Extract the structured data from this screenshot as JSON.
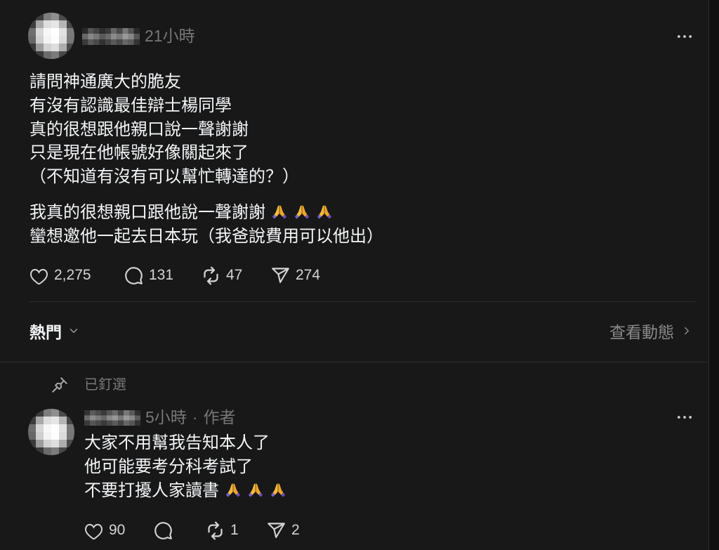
{
  "theme": {
    "page_background": "#101010",
    "card_background": "#181818",
    "primary_text": "#f3f5f7",
    "secondary_text": "#777777",
    "divider": "#2e2e2e"
  },
  "post": {
    "time": "21小時",
    "paragraphs": [
      {
        "lines": [
          "請問神通廣大的脆友",
          "有沒有認識最佳辯士楊同學",
          "真的很想跟他親口說一聲謝謝",
          "只是現在他帳號好像關起來了",
          "（不知道有沒有可以幫忙轉達的？）"
        ]
      },
      {
        "lines": [
          "我真的很想親口跟他說一聲謝謝",
          "蠻想邀他一起去日本玩（我爸說費用可以他出）"
        ],
        "trailing_emoji": {
          "icon": "folded-hands-emoji",
          "count": 3
        }
      }
    ],
    "stats": {
      "likes": "2,275",
      "comments": "131",
      "reposts": "47",
      "shares": "274"
    }
  },
  "replies_header": {
    "sort_label": "熱門",
    "view_activity_label": "查看動態"
  },
  "reply": {
    "pinned_label": "已釘選",
    "time": "5小時",
    "separator": "·",
    "author_badge": "作者",
    "lines": [
      "大家不用幫我告知本人了",
      "他可能要考分科考試了",
      "不要打擾人家讀書"
    ],
    "trailing_emoji": {
      "icon": "folded-hands-emoji",
      "count": 3
    },
    "stats": {
      "likes": "90",
      "reposts": "1",
      "shares": "2"
    }
  },
  "icons": {
    "like": "heart-icon",
    "comment": "comment-icon",
    "repost": "repost-icon",
    "share": "share-icon",
    "more": "more-icon",
    "pinned": "pin-icon",
    "sort_dropdown": "chevron-down-icon",
    "view_activity": "chevron-right-icon"
  }
}
